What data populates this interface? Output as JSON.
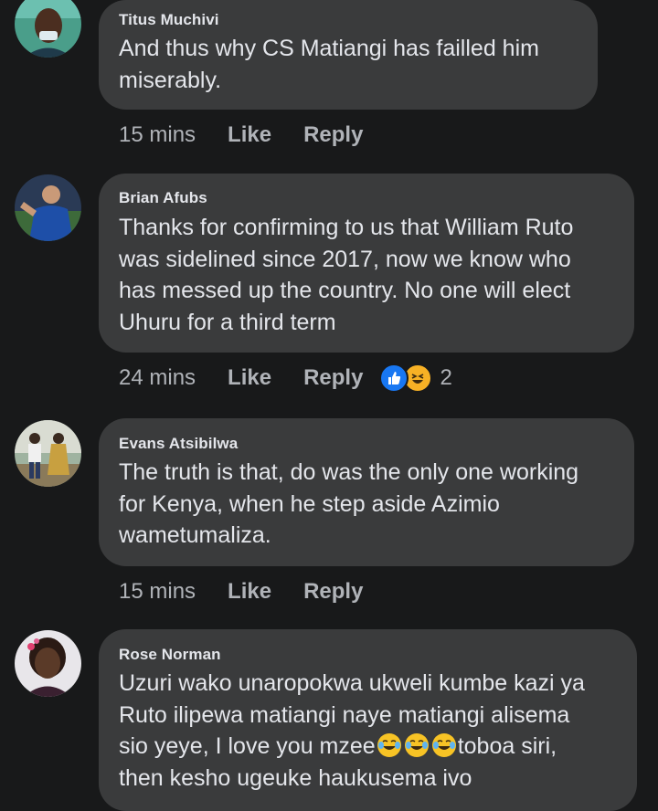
{
  "comments": [
    {
      "author": "Titus Muchivi",
      "text": "And thus why CS Matiangi has failled  him\nmiserably.",
      "time": "15 mins",
      "like_label": "Like",
      "reply_label": "Reply"
    },
    {
      "author": "Brian Afubs",
      "text": "Thanks for confirming to us that William Ruto\nwas sidelined since 2017, now we know who\nhas messed up the country. No one will elect\nUhuru for a third term",
      "time": "24 mins",
      "like_label": "Like",
      "reply_label": "Reply",
      "reaction_count": "2",
      "reactions": [
        "like-icon",
        "haha-icon"
      ]
    },
    {
      "author": "Evans Atsibilwa",
      "text": "The truth is that, do was the only one working\nfor Kenya, when he step aside Azimio\nwametumaliza.",
      "time": "15 mins",
      "like_label": "Like",
      "reply_label": "Reply"
    },
    {
      "author": "Rose Norman",
      "text_line1": "Uzuri wako unaropokwa ukweli kumbe kazi ya",
      "text_line2": "Ruto ilipewa matiangi naye matiangi alisema",
      "text_line3_a": "sio yeye, I love you mzee",
      "text_line3_b": "toboa siri,",
      "text_line4": "then kesho ugeuke haukusema ivo",
      "inline_emojis": [
        "tears-of-joy-icon",
        "tears-of-joy-icon",
        "tears-of-joy-icon"
      ]
    }
  ],
  "colors": {
    "background": "#18191a",
    "bubble": "#3a3b3c",
    "text": "#e4e6eb",
    "meta": "#b0b3b8",
    "like_reaction": "#1877f2",
    "haha_reaction": "#f7b125"
  }
}
